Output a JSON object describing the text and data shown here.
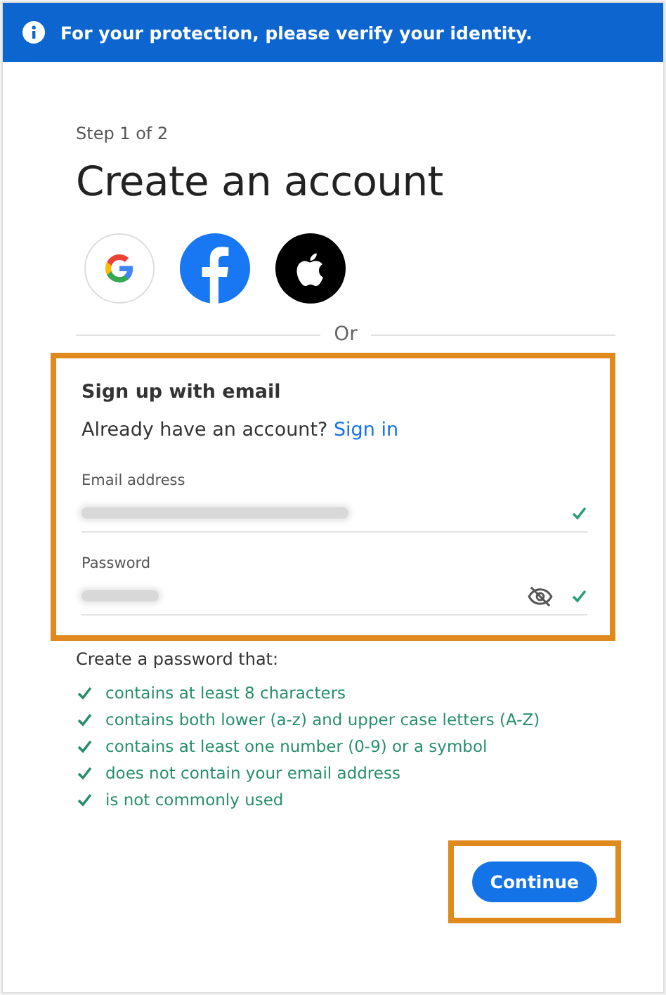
{
  "banner": {
    "text": "For your protection, please verify your identity."
  },
  "step": "Step 1 of 2",
  "title": "Create an account",
  "social_buttons": [
    {
      "kind": "google"
    },
    {
      "kind": "facebook"
    },
    {
      "kind": "apple"
    }
  ],
  "divider_text": "Or",
  "email_form": {
    "highlighted": true,
    "heading": "Sign up with email",
    "prompt": "Already have an account?",
    "link": "Sign in",
    "fields": [
      {
        "label": "Email address",
        "valid": true,
        "concealed": false
      },
      {
        "label": "Password",
        "valid": true,
        "concealed": true
      }
    ]
  },
  "requirements": {
    "heading": "Create a password that:",
    "items": [
      {
        "text": "contains at least 8 characters",
        "met": true
      },
      {
        "text": "contains both lower (a-z) and upper case letters (A-Z)",
        "met": true
      },
      {
        "text": "contains at least one number (0-9) or a symbol",
        "met": true
      },
      {
        "text": "does not contain your email address",
        "met": true
      },
      {
        "text": "is not commonly used",
        "met": true
      }
    ]
  },
  "continue_button": {
    "label": "Continue",
    "highlighted": true
  }
}
